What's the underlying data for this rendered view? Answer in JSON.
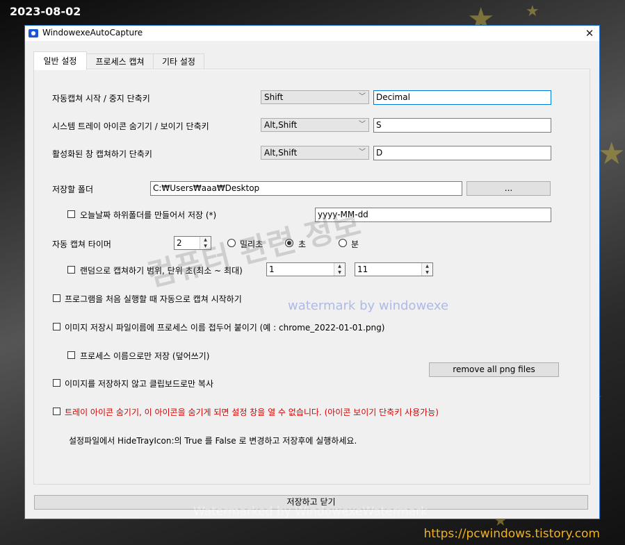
{
  "overlay": {
    "date": "2023-08-02",
    "site_url": "https://pcwindows.tistory.com",
    "watermark_big": "컴퓨터 관련 정보",
    "watermark_small": "watermark by windowexe",
    "watermark_bottom": "Watermarked by WindowexeWatermark"
  },
  "window": {
    "title": "WindowexeAutoCapture",
    "close_glyph": "✕",
    "accent_color": "#1c6fd1"
  },
  "tabs": [
    {
      "label": "일반 설정",
      "active": true
    },
    {
      "label": "프로세스 캡쳐",
      "active": false
    },
    {
      "label": "기타 설정",
      "active": false
    }
  ],
  "hotkeys": [
    {
      "label": "자동캡쳐 시작 / 중지 단축키",
      "modifier": "Shift",
      "key": "Decimal"
    },
    {
      "label": "시스템 트레이 아이콘 숨기기 / 보이기 단축키",
      "modifier": "Alt,Shift",
      "key": "S"
    },
    {
      "label": "활성화된 창 캡쳐하기 단축키",
      "modifier": "Alt,Shift",
      "key": "D"
    }
  ],
  "save_folder": {
    "label": "저장할 폴더",
    "path": "C:₩Users₩aaa₩Desktop",
    "browse_label": "..."
  },
  "date_subfolder": {
    "label": "오늘날짜 하위폴더를 만들어서 저장 (*)",
    "checked": false,
    "format": "yyyy-MM-dd"
  },
  "timer": {
    "label": "자동 캡쳐 타이머",
    "value": "2",
    "units": [
      {
        "label": "밀리초",
        "selected": false
      },
      {
        "label": "초",
        "selected": true
      },
      {
        "label": "분",
        "selected": false
      }
    ]
  },
  "random_range": {
    "label": "랜덤으로 캡쳐하기 범위, 단위 초(최소 ~ 최대)",
    "checked": false,
    "min": "1",
    "max": "11"
  },
  "options": {
    "start_on_launch": "프로그램을 처음 실행할 때 자동으로 캡쳐 시작하기",
    "prefix_process": "이미지 저장시 파일이름에 프로세스 이름 접두어 붙이기 (예 : chrome_2022-01-01.png)",
    "process_only": "프로세스 이름으로만 저장 (덮어쓰기)",
    "remove_png_label": "remove all png files",
    "clipboard_only": "이미지를 저장하지 않고 클립보드로만 복사",
    "hide_tray": "트레이 아이콘 숨기기, 이 아이콘을 숨기게 되면 설정 창을 열 수 없습니다. (아이콘 보이기 단축키 사용가능)",
    "hide_tray_color": "#d40000",
    "note": "설정파일에서 HideTrayIcon:의 True 를 False 로 변경하고 저장후에 실행하세요."
  },
  "footer": {
    "save_close_label": "저장하고 닫기"
  }
}
